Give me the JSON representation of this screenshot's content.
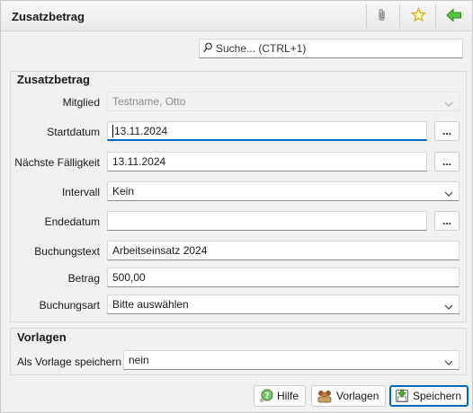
{
  "window": {
    "title": "Zusatzbetrag"
  },
  "toolbar": {
    "attach_icon": "paperclip-icon",
    "favorite_icon": "star-icon",
    "back_icon": "arrow-left-icon"
  },
  "search": {
    "placeholder": "Suche...   (CTRL+1)",
    "icon": "search-icon"
  },
  "section_main": {
    "title": "Zusatzbetrag",
    "mitglied": {
      "label": "Mitglied",
      "value": "Testname, Otto"
    },
    "startdatum": {
      "label": "Startdatum",
      "value": "13.11.2024",
      "button": "..."
    },
    "faelligkeit": {
      "label": "Nächste Fälligkeit",
      "value": "13.11.2024",
      "button": "..."
    },
    "intervall": {
      "label": "Intervall",
      "value": "Kein"
    },
    "endedatum": {
      "label": "Endedatum",
      "value": "",
      "button": "..."
    },
    "buchungstext": {
      "label": "Buchungstext",
      "value": "Arbeitseinsatz 2024"
    },
    "betrag": {
      "label": "Betrag",
      "value": "500,00"
    },
    "buchungsart": {
      "label": "Buchungsart",
      "value": "Bitte auswählen"
    }
  },
  "section_vorlagen": {
    "title": "Vorlagen",
    "als_vorlage": {
      "label": "Als Vorlage speichern",
      "value": "nein"
    }
  },
  "buttons": {
    "hilfe": "Hilfe",
    "vorlagen": "Vorlagen",
    "speichern": "Speichern"
  },
  "colors": {
    "accent": "#0067c0",
    "star": "#e6b800",
    "back_arrow": "#4caf2a"
  }
}
